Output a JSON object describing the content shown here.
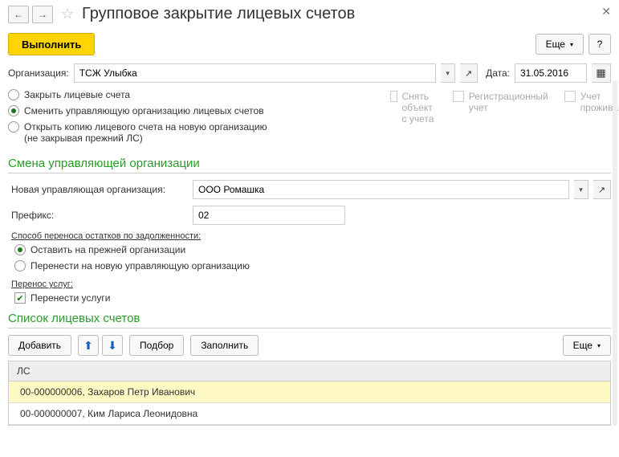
{
  "titlebar": {
    "title": "Групповое закрытие лицевых счетов"
  },
  "toolbar": {
    "execute": "Выполнить",
    "more": "Еще",
    "help": "?"
  },
  "fields": {
    "org_label": "Организация:",
    "org_value": "ТСЖ Улыбка",
    "date_label": "Дата:",
    "date_value": "31.05.2016"
  },
  "radios": {
    "close": "Закрыть лицевые счета",
    "change": "Сменить управляющую организацию лицевых счетов",
    "copy_line1": "Открыть копию лицевого счета на новую организацию",
    "copy_line2": "(не закрывая прежний ЛС)"
  },
  "checks": {
    "remove_line1": "Снять объект",
    "remove_line2": "с учета",
    "reg_line1": "Регистрационный",
    "reg_line2": "учет",
    "living_line1": "Учет",
    "living_line2": "проживающих"
  },
  "change_section": {
    "header": "Смена управляющей организации",
    "new_org_label": "Новая управляющая организация:",
    "new_org_value": "ООО Ромашка",
    "prefix_label": "Префикс:",
    "prefix_value": "02",
    "debt_header": "Способ переноса остатков по задолженности:",
    "debt_keep": "Оставить на прежней организации",
    "debt_move": "Перенести на новую управляющую организацию",
    "service_header": "Перенос услуг:",
    "service_move": "Перенести услуги"
  },
  "list_section": {
    "header": "Список лицевых счетов",
    "add": "Добавить",
    "select": "Подбор",
    "fill": "Заполнить",
    "more": "Еще",
    "col_ls": "ЛС",
    "rows": [
      "00-000000006, Захаров Петр Иванович",
      "00-000000007, Ким Лариса Леонидовна"
    ]
  }
}
